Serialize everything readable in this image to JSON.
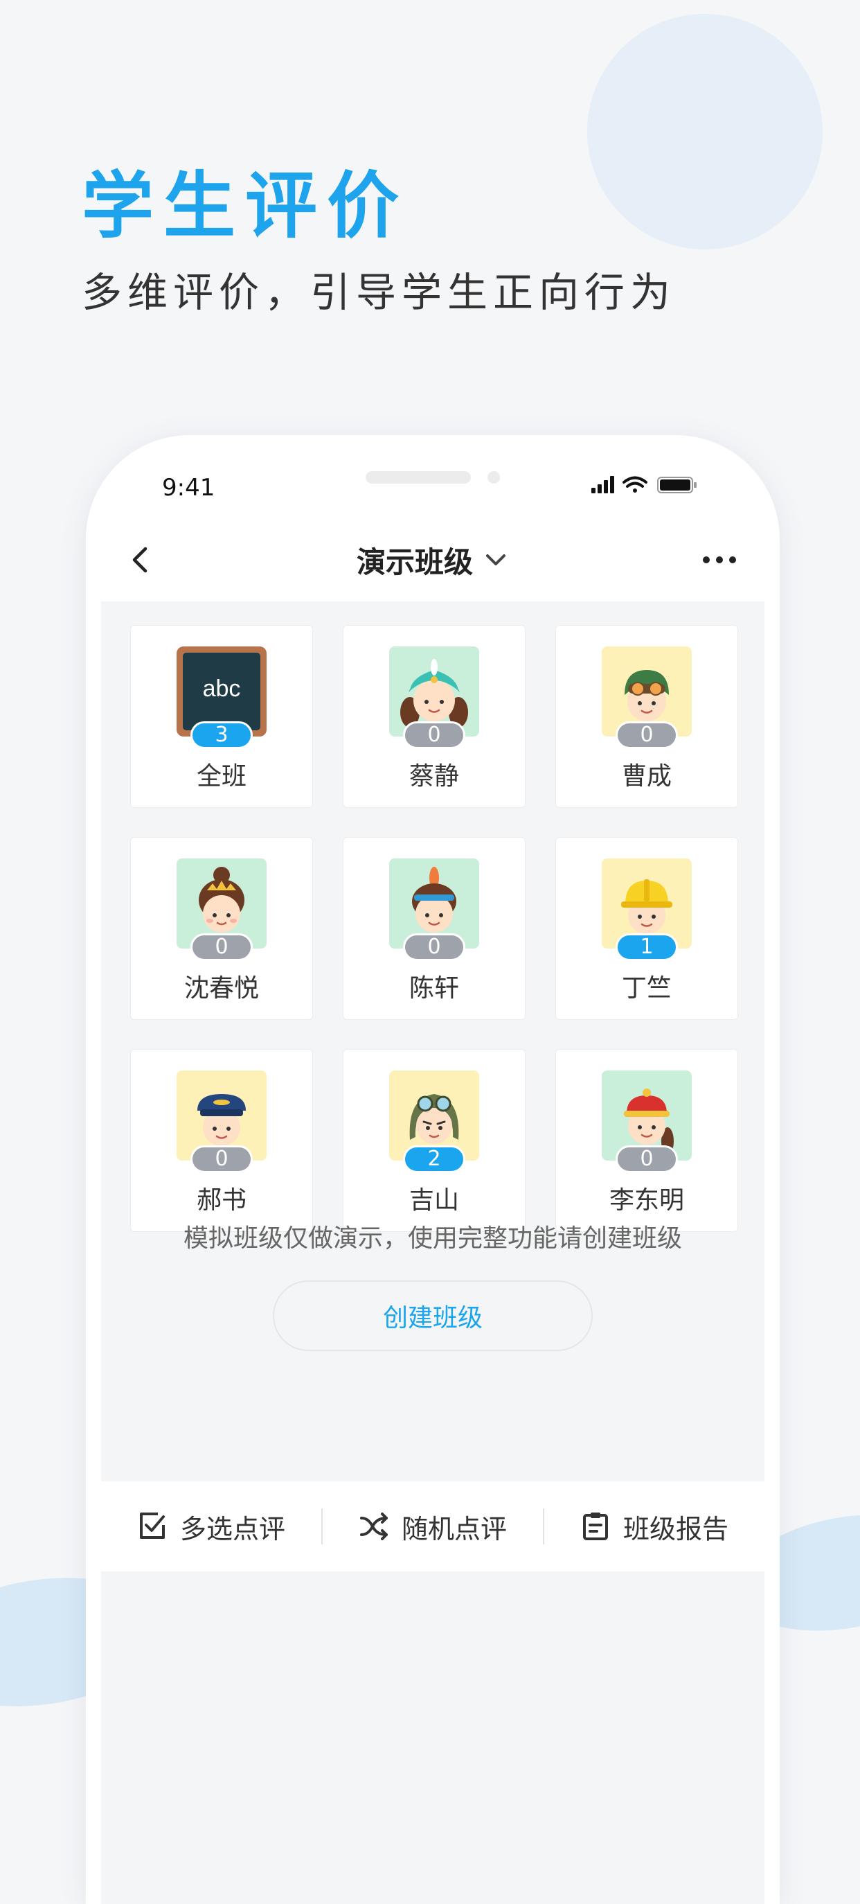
{
  "hero": {
    "title": "学生评价",
    "subtitle": "多维评价，引导学生正向行为"
  },
  "phone": {
    "status_time": "9:41"
  },
  "nav": {
    "title": "演示班级"
  },
  "students": [
    {
      "name": "全班",
      "score": "3",
      "avatar": "chalkboard-icon",
      "abc_text": "abc"
    },
    {
      "name": "蔡静",
      "score": "0",
      "avatar": "student-avatar-turban"
    },
    {
      "name": "曹成",
      "score": "0",
      "avatar": "student-avatar-pilot-goggles"
    },
    {
      "name": "沈春悦",
      "score": "0",
      "avatar": "student-avatar-crown-girl"
    },
    {
      "name": "陈轩",
      "score": "0",
      "avatar": "student-avatar-feather"
    },
    {
      "name": "丁竺",
      "score": "1",
      "avatar": "student-avatar-hardhat"
    },
    {
      "name": "郝书",
      "score": "0",
      "avatar": "student-avatar-pilot-cap"
    },
    {
      "name": "吉山",
      "score": "2",
      "avatar": "student-avatar-aviator"
    },
    {
      "name": "李东明",
      "score": "0",
      "avatar": "student-avatar-red-hat"
    }
  ],
  "notice": "模拟班级仅做演示，使用完整功能请创建班级",
  "create_button": "创建班级",
  "bottom_bar": {
    "multi_select": "多选点评",
    "random": "随机点评",
    "report": "班级报告"
  },
  "colors": {
    "accent": "#1aa5ee",
    "badge_zero": "#9ea3ab",
    "title_blue": "#1da4ec"
  }
}
